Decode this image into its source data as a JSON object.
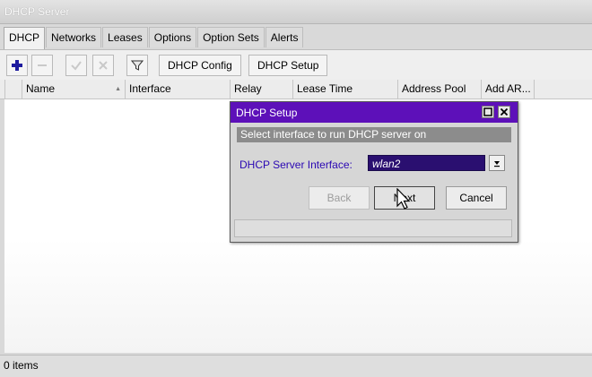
{
  "window": {
    "title": "DHCP Server"
  },
  "tabs": [
    {
      "label": "DHCP",
      "active": true
    },
    {
      "label": "Networks"
    },
    {
      "label": "Leases"
    },
    {
      "label": "Options"
    },
    {
      "label": "Option Sets"
    },
    {
      "label": "Alerts"
    }
  ],
  "toolbar": {
    "icons": [
      "plus-icon",
      "minus-icon",
      "check-icon",
      "cross-icon",
      "filter-icon"
    ],
    "dhcp_config_label": "DHCP Config",
    "dhcp_setup_label": "DHCP Setup"
  },
  "table": {
    "columns": [
      "Name",
      "Interface",
      "Relay",
      "Lease Time",
      "Address Pool",
      "Add AR..."
    ],
    "sort_indicator": "▲",
    "rows": []
  },
  "status": {
    "text": "0 items"
  },
  "dialog": {
    "title": "DHCP Setup",
    "hint": "Select interface to run DHCP server on",
    "field_label": "DHCP Server Interface:",
    "field_value": "wlan2",
    "back_label": "Back",
    "next_label": "Next",
    "cancel_label": "Cancel"
  },
  "colors": {
    "dialog_title_bg": "#5d10b9",
    "field_label": "#2a07b3",
    "selected_field_bg": "#2a0f70",
    "add_icon": "#1d1a9e"
  }
}
